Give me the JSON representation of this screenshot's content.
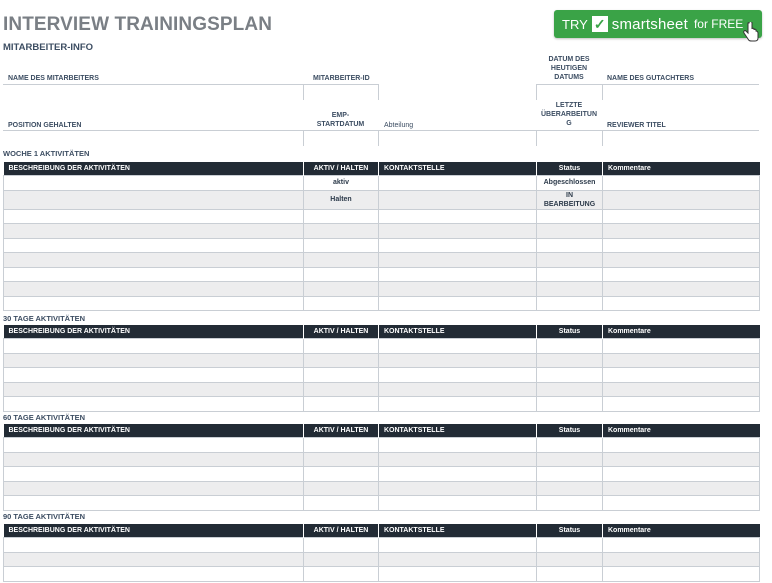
{
  "header": {
    "title": "INTERVIEW TRAININGSPLAN",
    "subtitle": "MITARBEITER-INFO"
  },
  "banner": {
    "try": "TRY",
    "brand": "smartsheet",
    "free": "for FREE",
    "color": "#3aa347",
    "icon": "check-icon"
  },
  "info": {
    "employee_name": "NAME DES MITARBEITERS",
    "employee_id": "MITARBEITER-ID",
    "today_date_line1": "DATUM DES",
    "today_date_line2": "HEUTIGEN",
    "today_date_line3": "DATUMS",
    "reviewer_name": "NAME DES GUTACHTERS",
    "position": "POSITION GEHALTEN",
    "emp_start_line1": "EMP-",
    "emp_start_line2": "STARTDATUM",
    "department": "Abteilung",
    "last_review_line1": "LETZTE",
    "last_review_line2": "ÜBERARBEITUN",
    "last_review_line3": "G",
    "reviewer_title": "REVIEWER TITEL"
  },
  "columns": {
    "description": "BESCHREIBUNG DER AKTIVITÄTEN",
    "active": "AKTIV / HALTEN",
    "contact": "KONTAKTSTELLE",
    "status": "Status",
    "comments": "Kommentare"
  },
  "sections": {
    "week1": {
      "title": "WOCHE 1 AKTIVITÄTEN",
      "row1_active": "aktiv",
      "row1_status": "Abgeschlossen",
      "row2_active": "Halten",
      "row2_status_line1": "IN",
      "row2_status_line2": "BEARBEITUNG"
    },
    "days30": {
      "title": "30 TAGE AKTIVITÄTEN"
    },
    "days60": {
      "title": "60 TAGE AKTIVITÄTEN"
    },
    "days90": {
      "title": "90 TAGE AKTIVITÄTEN"
    }
  },
  "colors": {
    "header_dark": "#222b35",
    "stripe": "#ededee",
    "title_gray": "#7a7f85"
  }
}
